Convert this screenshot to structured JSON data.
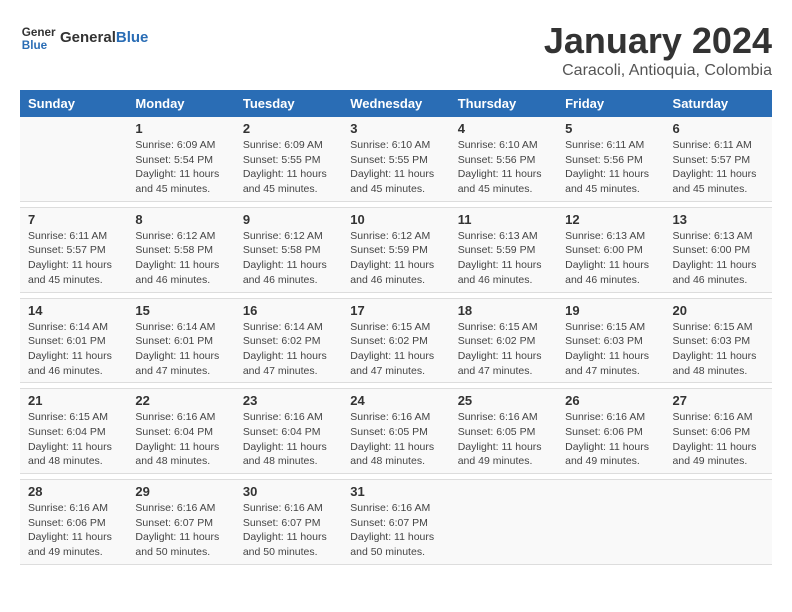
{
  "logo": {
    "text_general": "General",
    "text_blue": "Blue"
  },
  "title": "January 2024",
  "subtitle": "Caracoli, Antioquia, Colombia",
  "days_of_week": [
    "Sunday",
    "Monday",
    "Tuesday",
    "Wednesday",
    "Thursday",
    "Friday",
    "Saturday"
  ],
  "weeks": [
    [
      {
        "day": "",
        "info": ""
      },
      {
        "day": "1",
        "info": "Sunrise: 6:09 AM\nSunset: 5:54 PM\nDaylight: 11 hours\nand 45 minutes."
      },
      {
        "day": "2",
        "info": "Sunrise: 6:09 AM\nSunset: 5:55 PM\nDaylight: 11 hours\nand 45 minutes."
      },
      {
        "day": "3",
        "info": "Sunrise: 6:10 AM\nSunset: 5:55 PM\nDaylight: 11 hours\nand 45 minutes."
      },
      {
        "day": "4",
        "info": "Sunrise: 6:10 AM\nSunset: 5:56 PM\nDaylight: 11 hours\nand 45 minutes."
      },
      {
        "day": "5",
        "info": "Sunrise: 6:11 AM\nSunset: 5:56 PM\nDaylight: 11 hours\nand 45 minutes."
      },
      {
        "day": "6",
        "info": "Sunrise: 6:11 AM\nSunset: 5:57 PM\nDaylight: 11 hours\nand 45 minutes."
      }
    ],
    [
      {
        "day": "7",
        "info": "Sunrise: 6:11 AM\nSunset: 5:57 PM\nDaylight: 11 hours\nand 45 minutes."
      },
      {
        "day": "8",
        "info": "Sunrise: 6:12 AM\nSunset: 5:58 PM\nDaylight: 11 hours\nand 46 minutes."
      },
      {
        "day": "9",
        "info": "Sunrise: 6:12 AM\nSunset: 5:58 PM\nDaylight: 11 hours\nand 46 minutes."
      },
      {
        "day": "10",
        "info": "Sunrise: 6:12 AM\nSunset: 5:59 PM\nDaylight: 11 hours\nand 46 minutes."
      },
      {
        "day": "11",
        "info": "Sunrise: 6:13 AM\nSunset: 5:59 PM\nDaylight: 11 hours\nand 46 minutes."
      },
      {
        "day": "12",
        "info": "Sunrise: 6:13 AM\nSunset: 6:00 PM\nDaylight: 11 hours\nand 46 minutes."
      },
      {
        "day": "13",
        "info": "Sunrise: 6:13 AM\nSunset: 6:00 PM\nDaylight: 11 hours\nand 46 minutes."
      }
    ],
    [
      {
        "day": "14",
        "info": "Sunrise: 6:14 AM\nSunset: 6:01 PM\nDaylight: 11 hours\nand 46 minutes."
      },
      {
        "day": "15",
        "info": "Sunrise: 6:14 AM\nSunset: 6:01 PM\nDaylight: 11 hours\nand 47 minutes."
      },
      {
        "day": "16",
        "info": "Sunrise: 6:14 AM\nSunset: 6:02 PM\nDaylight: 11 hours\nand 47 minutes."
      },
      {
        "day": "17",
        "info": "Sunrise: 6:15 AM\nSunset: 6:02 PM\nDaylight: 11 hours\nand 47 minutes."
      },
      {
        "day": "18",
        "info": "Sunrise: 6:15 AM\nSunset: 6:02 PM\nDaylight: 11 hours\nand 47 minutes."
      },
      {
        "day": "19",
        "info": "Sunrise: 6:15 AM\nSunset: 6:03 PM\nDaylight: 11 hours\nand 47 minutes."
      },
      {
        "day": "20",
        "info": "Sunrise: 6:15 AM\nSunset: 6:03 PM\nDaylight: 11 hours\nand 48 minutes."
      }
    ],
    [
      {
        "day": "21",
        "info": "Sunrise: 6:15 AM\nSunset: 6:04 PM\nDaylight: 11 hours\nand 48 minutes."
      },
      {
        "day": "22",
        "info": "Sunrise: 6:16 AM\nSunset: 6:04 PM\nDaylight: 11 hours\nand 48 minutes."
      },
      {
        "day": "23",
        "info": "Sunrise: 6:16 AM\nSunset: 6:04 PM\nDaylight: 11 hours\nand 48 minutes."
      },
      {
        "day": "24",
        "info": "Sunrise: 6:16 AM\nSunset: 6:05 PM\nDaylight: 11 hours\nand 48 minutes."
      },
      {
        "day": "25",
        "info": "Sunrise: 6:16 AM\nSunset: 6:05 PM\nDaylight: 11 hours\nand 49 minutes."
      },
      {
        "day": "26",
        "info": "Sunrise: 6:16 AM\nSunset: 6:06 PM\nDaylight: 11 hours\nand 49 minutes."
      },
      {
        "day": "27",
        "info": "Sunrise: 6:16 AM\nSunset: 6:06 PM\nDaylight: 11 hours\nand 49 minutes."
      }
    ],
    [
      {
        "day": "28",
        "info": "Sunrise: 6:16 AM\nSunset: 6:06 PM\nDaylight: 11 hours\nand 49 minutes."
      },
      {
        "day": "29",
        "info": "Sunrise: 6:16 AM\nSunset: 6:07 PM\nDaylight: 11 hours\nand 50 minutes."
      },
      {
        "day": "30",
        "info": "Sunrise: 6:16 AM\nSunset: 6:07 PM\nDaylight: 11 hours\nand 50 minutes."
      },
      {
        "day": "31",
        "info": "Sunrise: 6:16 AM\nSunset: 6:07 PM\nDaylight: 11 hours\nand 50 minutes."
      },
      {
        "day": "",
        "info": ""
      },
      {
        "day": "",
        "info": ""
      },
      {
        "day": "",
        "info": ""
      }
    ]
  ]
}
